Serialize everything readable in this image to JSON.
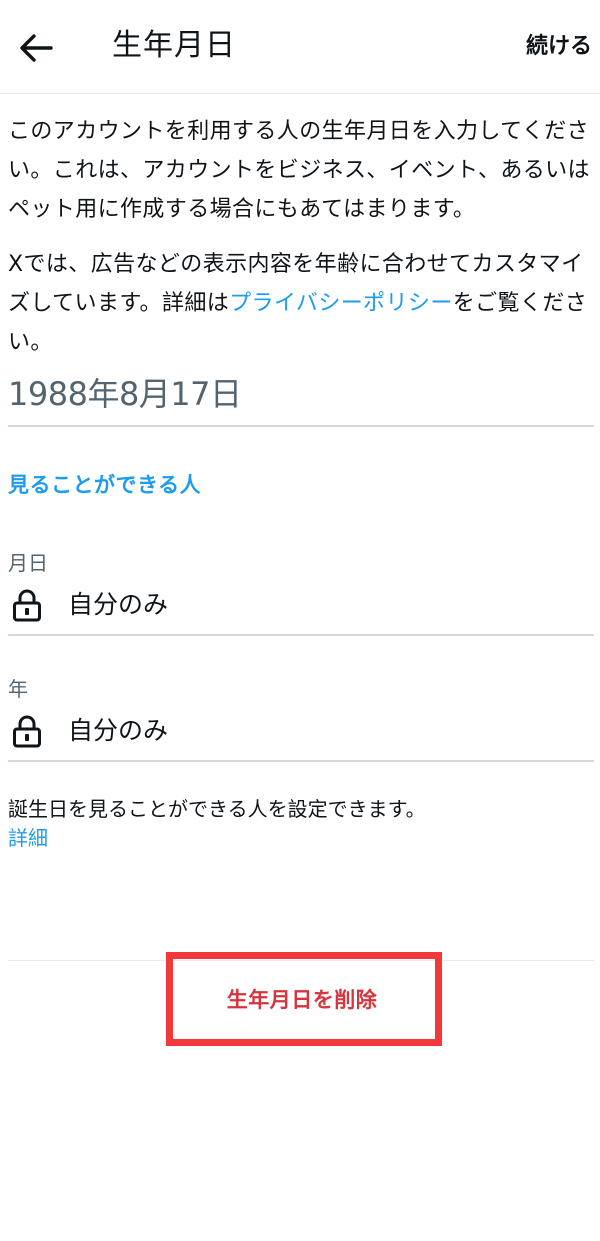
{
  "header": {
    "title": "生年月日",
    "continue_label": "続ける",
    "back_icon": "arrow-left-icon"
  },
  "description": {
    "paragraph1": "このアカウントを利用する人の生年月日を入力してください。これは、アカウントをビジネス、イベント、あるいはペット用に作成する場合にもあてはまります。",
    "paragraph2_before": "Xでは、広告などの表示内容を年齢に合わせてカスタマイズしています。詳細は",
    "paragraph2_link": "プライバシーポリシー",
    "paragraph2_after": "をご覧ください。"
  },
  "birthdate": {
    "value": "1988年8月17日"
  },
  "visibility": {
    "heading": "見ることができる人",
    "rows": [
      {
        "label": "月日",
        "value": "自分のみ",
        "icon": "lock-icon"
      },
      {
        "label": "年",
        "value": "自分のみ",
        "icon": "lock-icon"
      }
    ],
    "note": "誕生日を見ることができる人を設定できます。",
    "note_link": "詳細"
  },
  "footer": {
    "delete_label": "生年月日を削除"
  },
  "colors": {
    "link": "#1d9bf0",
    "delete": "#d8343d",
    "highlight_box": "#f2383a",
    "muted_text": "#536471"
  }
}
